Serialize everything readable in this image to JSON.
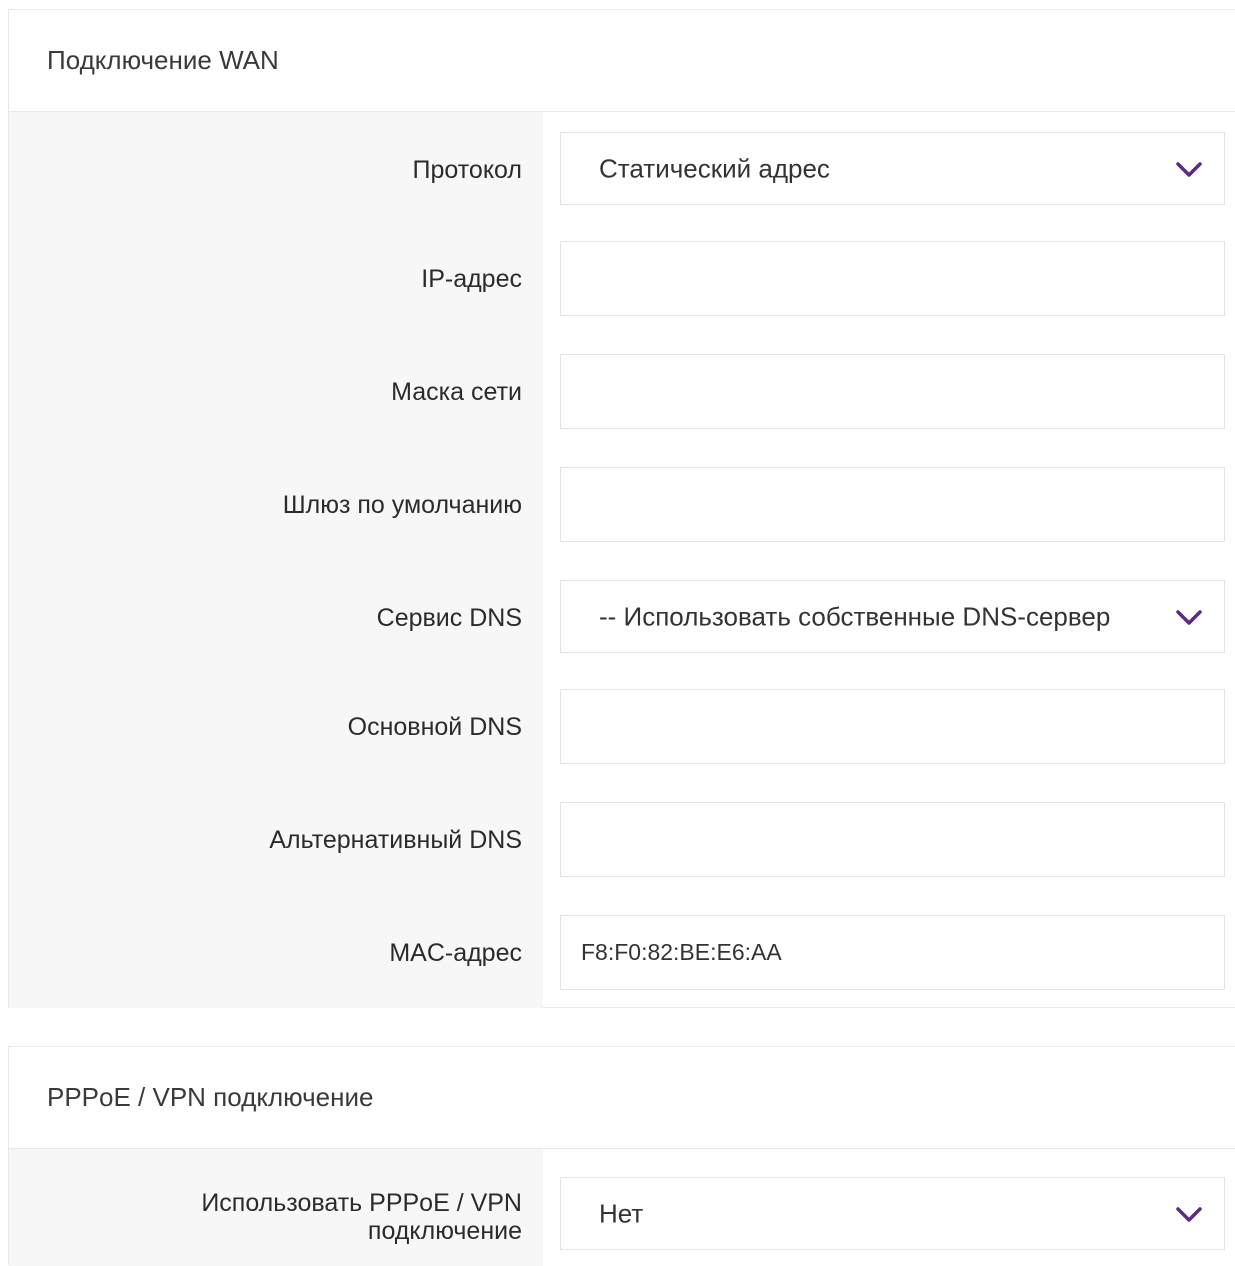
{
  "wan": {
    "title": "Подключение WAN",
    "protocol": {
      "label": "Протокол",
      "value": "Статический адрес"
    },
    "ip": {
      "label": "IP-адрес",
      "value": ""
    },
    "mask": {
      "label": "Маска сети",
      "value": ""
    },
    "gateway": {
      "label": "Шлюз по умолчанию",
      "value": ""
    },
    "dns_service": {
      "label": "Сервис DNS",
      "value": "-- Использовать собственные DNS-сервер"
    },
    "dns_primary": {
      "label": "Основной DNS",
      "value": ""
    },
    "dns_alt": {
      "label": "Альтернативный DNS",
      "value": ""
    },
    "mac": {
      "label": "MAC-адрес",
      "value": "F8:F0:82:BE:E6:AA"
    }
  },
  "pppoe": {
    "title": "PPPoE / VPN подключение",
    "use": {
      "label_line1": "Использовать PPPoE / VPN",
      "label_line2": "подключение",
      "value": "Нет"
    }
  },
  "colors": {
    "accent": "#5b2a86",
    "label_bg": "#f7f7f7",
    "border": "#e3e3e3"
  },
  "icons": {
    "dropdown": "chevron-down-icon"
  }
}
